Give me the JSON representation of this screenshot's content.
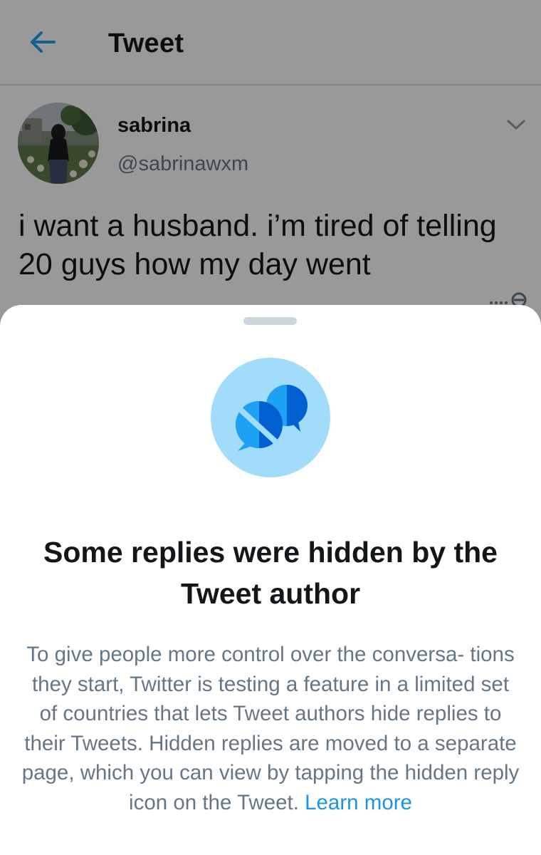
{
  "app_bar": {
    "title": "Tweet",
    "back_icon": "arrow-left-icon"
  },
  "tweet": {
    "display_name": "sabrina",
    "handle": "@sabrinawxm",
    "text": "i want a husband. i’m tired of telling 20 guys how my day went",
    "menu_icon": "chevron-down-icon",
    "hidden_reply_icon": "hidden-reply-icon"
  },
  "sheet": {
    "illustration_icon": "hidden-replies-icon",
    "title": "Some replies were hidden by the Tweet author",
    "body": "To give people more control over the conversa- tions they start, Twitter is testing a feature in a limited set of countries that lets Tweet authors hide replies to their Tweets. Hidden replies are moved to a separate page, which you can view by tapping the hidden reply icon on the Tweet. ",
    "learn_more": "Learn more"
  },
  "colors": {
    "accent": "#1b95e0",
    "text_primary": "#14171a",
    "text_secondary": "#657786",
    "illustration_bg": "#a2dcfb",
    "bubble_dark": "#005fd1",
    "bubble_light": "#1da1f2"
  }
}
